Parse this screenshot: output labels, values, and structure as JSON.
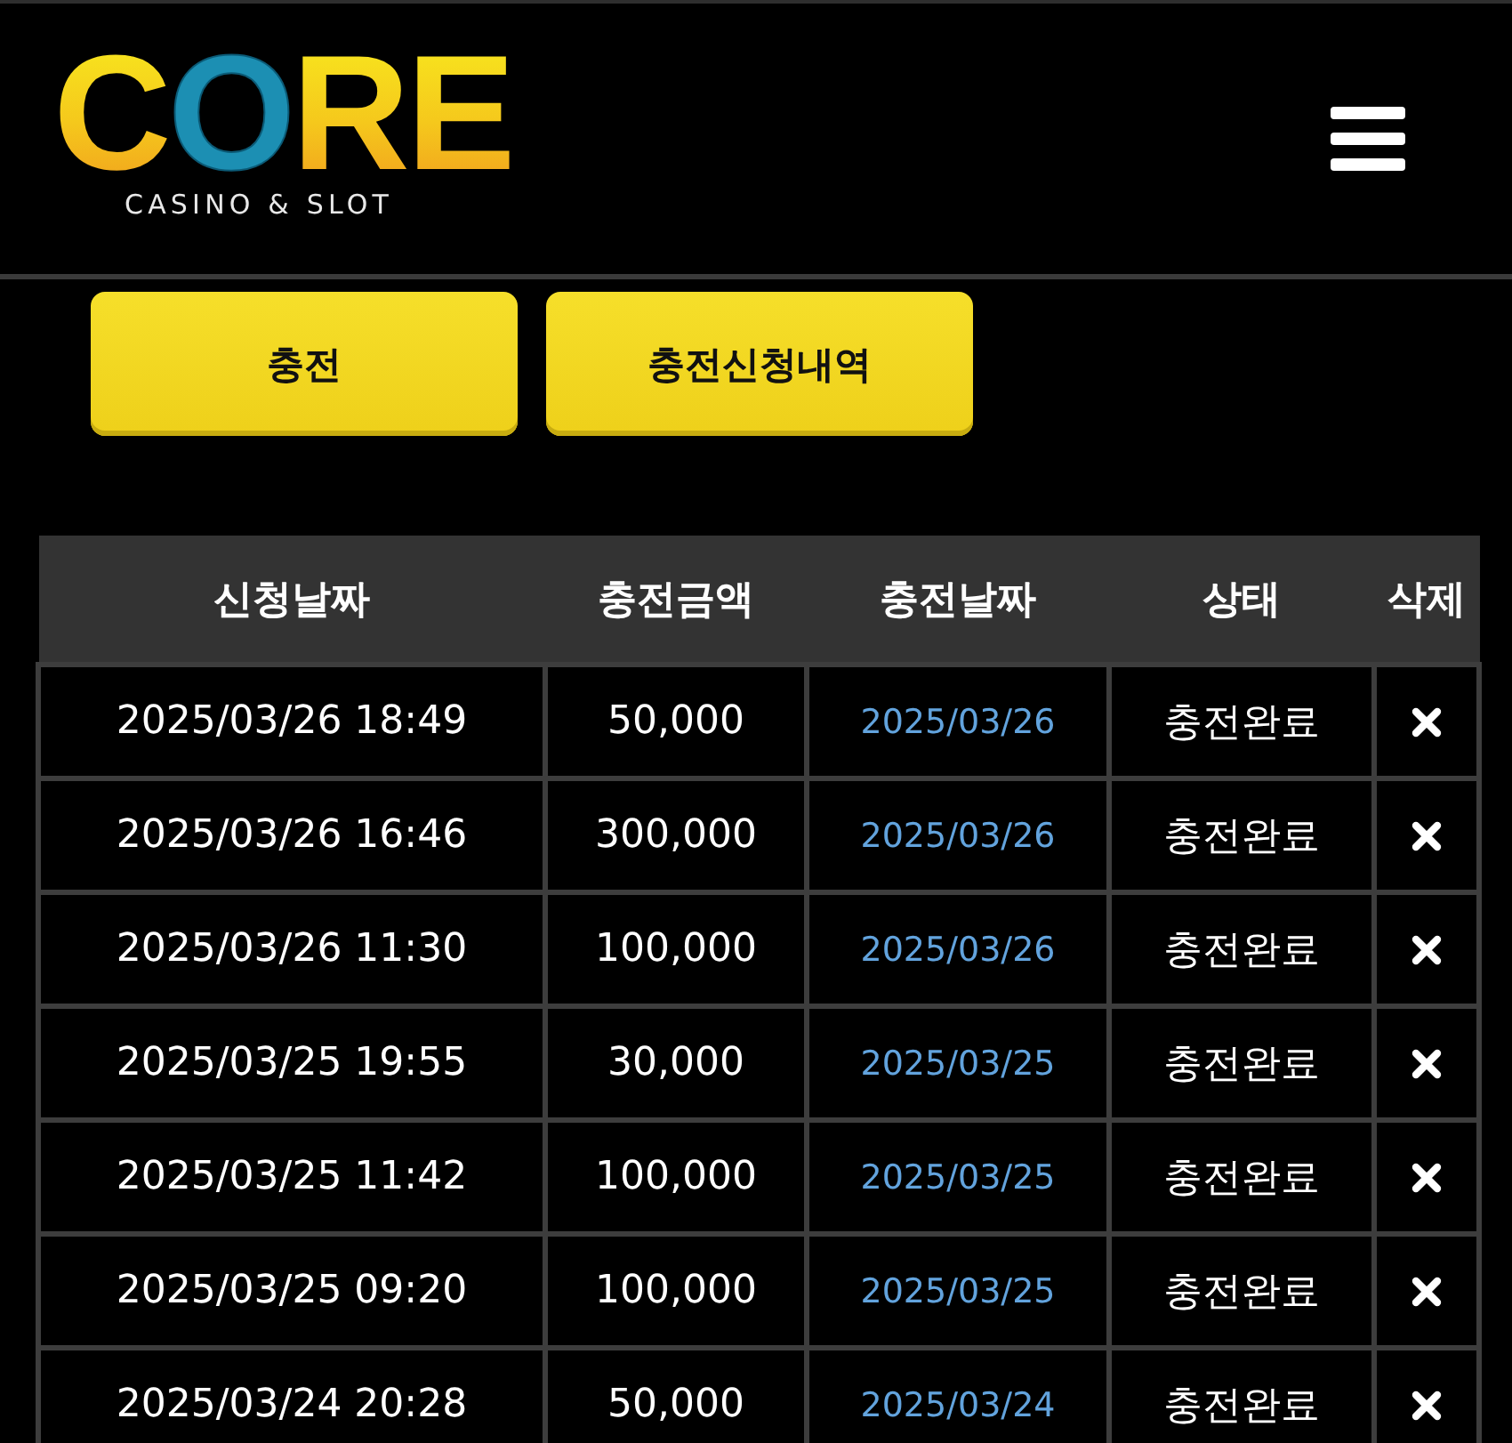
{
  "header": {
    "logo": {
      "wordmark": "CORE",
      "tagline": "CASINO & SLOT"
    }
  },
  "buttons": [
    "충전",
    "충전신청내역"
  ],
  "table": {
    "columns": [
      "신청날짜",
      "충전금액",
      "충전날짜",
      "상태",
      "삭제"
    ],
    "rows": [
      {
        "requested_at": "2025/03/26 18:49",
        "amount": "50,000",
        "charged_date": "2025/03/26",
        "status": "충전완료"
      },
      {
        "requested_at": "2025/03/26 16:46",
        "amount": "300,000",
        "charged_date": "2025/03/26",
        "status": "충전완료"
      },
      {
        "requested_at": "2025/03/26 11:30",
        "amount": "100,000",
        "charged_date": "2025/03/26",
        "status": "충전완료"
      },
      {
        "requested_at": "2025/03/25 19:55",
        "amount": "30,000",
        "charged_date": "2025/03/25",
        "status": "충전완료"
      },
      {
        "requested_at": "2025/03/25 11:42",
        "amount": "100,000",
        "charged_date": "2025/03/25",
        "status": "충전완료"
      },
      {
        "requested_at": "2025/03/25 09:20",
        "amount": "100,000",
        "charged_date": "2025/03/25",
        "status": "충전완료"
      },
      {
        "requested_at": "2025/03/24 20:28",
        "amount": "50,000",
        "charged_date": "2025/03/24",
        "status": "충전완료"
      }
    ]
  }
}
